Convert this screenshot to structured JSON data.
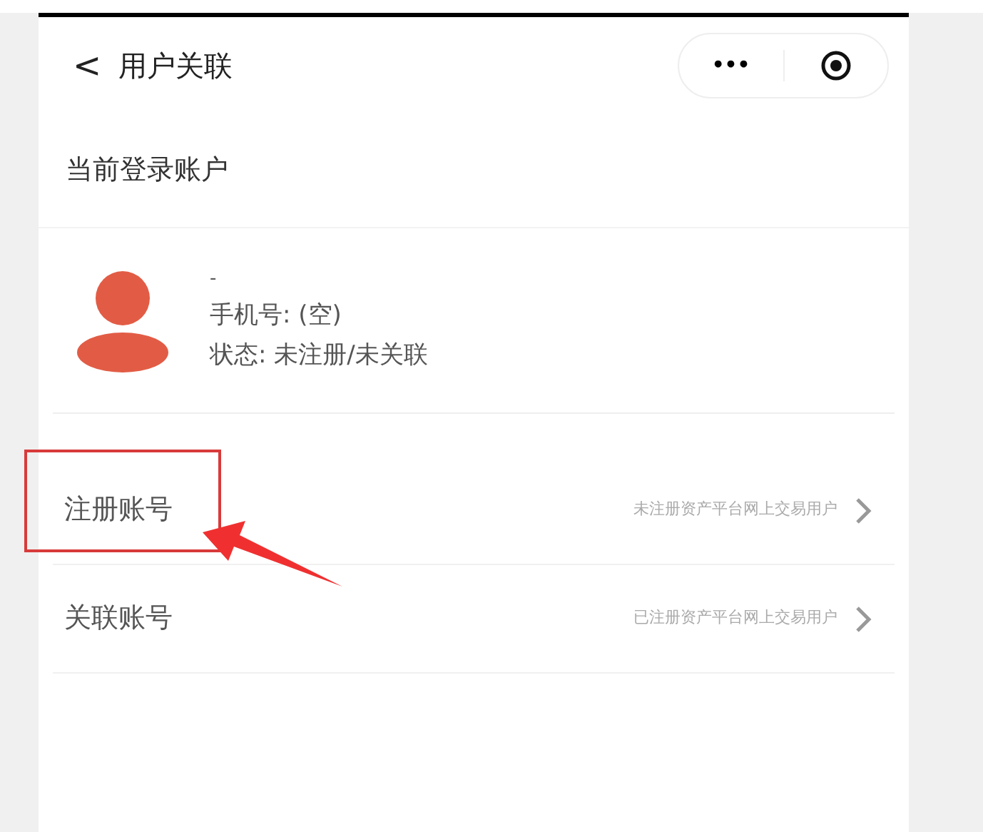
{
  "header": {
    "back": "<",
    "title": "用户关联",
    "more": "•••"
  },
  "section_title": "当前登录账户",
  "account": {
    "name": "-",
    "phone": "手机号: (空)",
    "status": "状态: 未注册/未关联"
  },
  "actions": [
    {
      "label": "注册账号",
      "hint": "未注册资产平台网上交易用户",
      "highlighted": true
    },
    {
      "label": "关联账号",
      "hint": "已注册资产平台网上交易用户",
      "highlighted": false
    }
  ]
}
